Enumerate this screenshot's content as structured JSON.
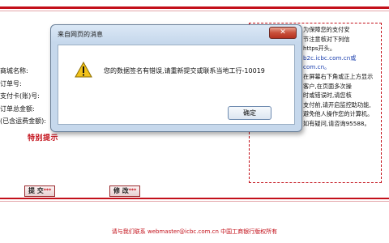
{
  "form": {
    "labels": [
      "商城名称:",
      "订单号:",
      "支付卡(账)号:",
      "订单总金额:",
      "(已含运费金额):"
    ],
    "warning": "特别提示"
  },
  "tips": {
    "lines": [
      "为保障您的支付安",
      "节注意核对下列信",
      "",
      "",
      "https开头。",
      "b2c.icbc.com.cn或",
      "com.cn。",
      "在屏幕右下角或正上方显示",
      "",
      "",
      "客户,在页面多次操",
      "时或错误时,请您核",
      "",
      "支付前,请开启监控助功能,",
      "避免他人操作您的计算机。",
      "如有疑问,请咨询95588。"
    ]
  },
  "buttons": {
    "submit": "提 交",
    "modify": "修 改",
    "dots": "***"
  },
  "footer": "请与我们联系 webmaster@icbc.com.cn 中国工商银行版权所有",
  "dialog": {
    "title": "来自网页的消息",
    "close": "✕",
    "message": "您的数据签名有错误,请重新提交或联系当地工行-10019",
    "ok": "确定"
  },
  "colors": {
    "accent": "#c3101a",
    "dialog_frame": "#c6d8ec",
    "close_red": "#c9503a"
  },
  "icons": {
    "warning": "warning-icon",
    "close": "close-icon"
  }
}
